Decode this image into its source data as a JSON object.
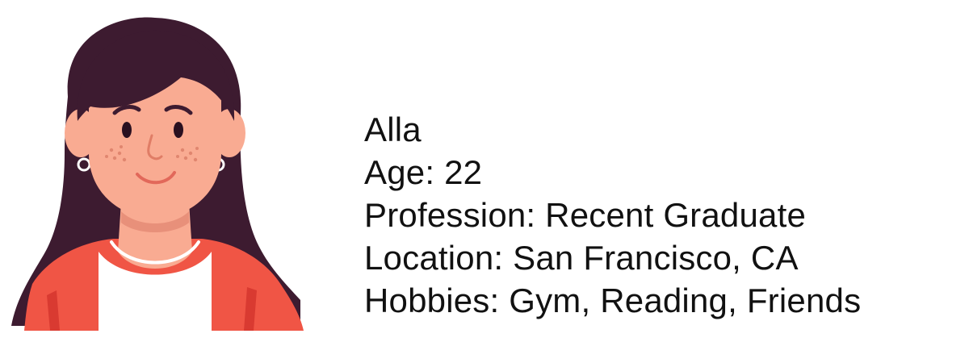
{
  "persona": {
    "name": "Alla",
    "age_label": "Age: 22",
    "profession_label": "Profession: Recent Graduate",
    "location_label": "Location: San Francisco, CA",
    "hobbies_label": "Hobbies: Gym, Reading, Friends"
  },
  "avatar": {
    "icon": "woman-avatar-illustration",
    "colors": {
      "hair": "#3d1b30",
      "skin": "#f9ab92",
      "jacket": "#f05545",
      "shirt": "#ffffff",
      "accent": "#d93a31"
    }
  }
}
